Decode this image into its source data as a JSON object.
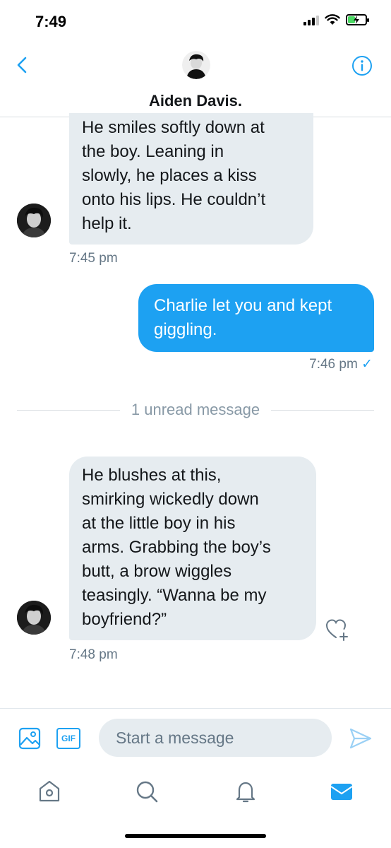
{
  "status_bar": {
    "time": "7:49",
    "battery_level": 0.4,
    "icons": [
      "signal-icon",
      "wifi-icon",
      "battery-charging-icon"
    ]
  },
  "header": {
    "name": "Aiden Davis.",
    "back_icon": "chevron-left-icon",
    "info_icon": "info-icon"
  },
  "messages": [
    {
      "direction": "incoming",
      "lines": [
        "He smiles softly down at",
        "the boy. Leaning in",
        "slowly, he places a kiss",
        "onto his lips. He couldn’t",
        "help it."
      ],
      "time": "7:45 pm"
    },
    {
      "direction": "outgoing",
      "lines": [
        "Charlie let you and kept",
        "giggling."
      ],
      "time": "7:46 pm",
      "status": "✓"
    },
    {
      "direction": "incoming",
      "lines": [
        "He blushes at this,",
        "smirking wickedly down",
        "at the little boy in his",
        "arms. Grabbing the boy’s",
        "butt, a brow wiggles",
        "teasingly. “Wanna be my",
        "boyfriend?”"
      ],
      "time": "7:48 pm"
    }
  ],
  "unread_divider": "1 unread message",
  "composer": {
    "placeholder": "Start a message",
    "gif_label": "GIF"
  },
  "colors": {
    "accent": "#1da1f2",
    "bubble_incoming": "#e6ecf0",
    "muted": "#657786"
  }
}
